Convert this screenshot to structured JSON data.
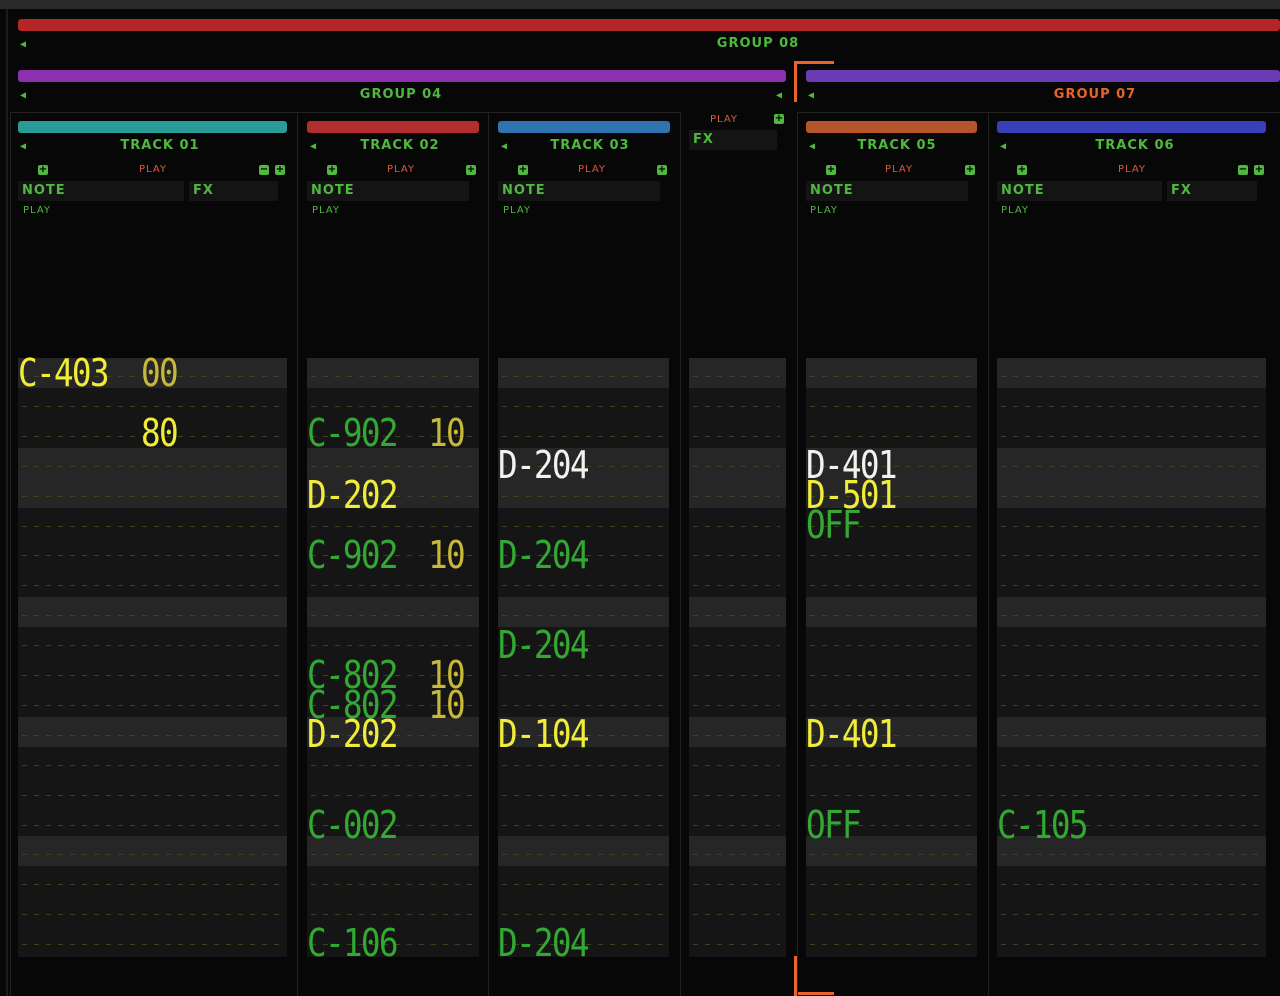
{
  "groups": {
    "group08": {
      "label": "GROUP 08",
      "color": "#b42626"
    },
    "group04": {
      "label": "GROUP 04",
      "color": "#8d2fae"
    },
    "group07": {
      "label": "GROUP 07",
      "color": "#6a3cb4"
    }
  },
  "tracks": [
    {
      "label": "TRACK 01",
      "color": "#2a9b96",
      "play": "PLAY",
      "note_field": "NOTE",
      "fx_field": "FX",
      "sub_play": "PLAY"
    },
    {
      "label": "TRACK 02",
      "color": "#b22d2d",
      "play": "PLAY",
      "note_field": "NOTE",
      "sub_play": "PLAY"
    },
    {
      "label": "TRACK 03",
      "color": "#2f74b0",
      "play": "PLAY",
      "note_field": "NOTE",
      "sub_play": "PLAY"
    },
    {
      "label": "TRACK 05",
      "color": "#b7552a",
      "play": "PLAY",
      "note_field": "NOTE",
      "sub_play": "PLAY"
    },
    {
      "label": "TRACK 06",
      "color": "#3a3fb7",
      "play": "PLAY",
      "note_field": "NOTE",
      "fx_field": "FX",
      "sub_play": "PLAY"
    }
  ],
  "group_fx": {
    "play": "PLAY",
    "fx_field": "FX"
  },
  "notes": {
    "t1_r0_note": "C-403",
    "t1_r0_vel": "00",
    "t1_r2_vel": "80",
    "t2_r2_note": "C-902",
    "t2_r2_vel": "10",
    "t2_r4_note": "D-202",
    "t2_r6_note": "C-902",
    "t2_r6_vel": "10",
    "t2_r10_note": "C-802",
    "t2_r10_vel": "10",
    "t2_r11_note": "C-802",
    "t2_r11_vel": "10",
    "t2_r12_note": "D-202",
    "t2_r15_note": "C-002",
    "t2_r19_note": "C-106",
    "t3_r3_note": "D-204",
    "t3_r6_note": "D-204",
    "t3_r9_note": "D-204",
    "t3_r12_note": "D-104",
    "t3_r19_note": "D-204",
    "t5_r3_note": "D-401",
    "t5_r4_note": "D-501",
    "t5_r5_note": "OFF",
    "t5_r12_note": "D-401",
    "t5_r15_note": "OFF",
    "t6_r15_note": "C-105"
  }
}
